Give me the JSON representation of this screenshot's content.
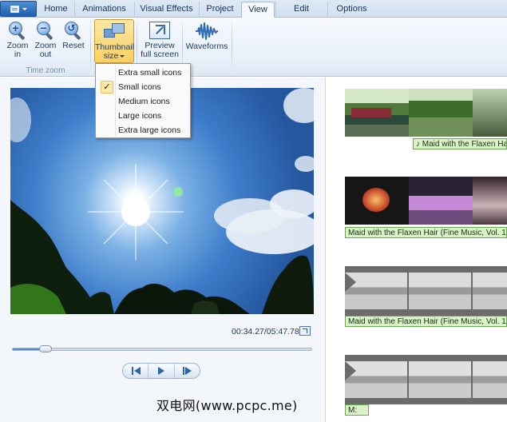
{
  "ribbon": {
    "tabs": [
      "Home",
      "Animations",
      "Visual Effects",
      "Project",
      "View",
      "Edit",
      "Options"
    ],
    "active_tab": "View",
    "zoom_in_label": [
      "Zoom",
      "in"
    ],
    "zoom_out_label": [
      "Zoom",
      "out"
    ],
    "reset_label": "Reset",
    "time_zoom_group": "Time zoom",
    "thumbnail_size_label": [
      "Thumbnail",
      "size"
    ],
    "preview_full_screen_label": [
      "Preview",
      "full screen"
    ],
    "waveforms_label": "Waveforms"
  },
  "thumbnail_menu": {
    "items": [
      "Extra small icons",
      "Small icons",
      "Medium icons",
      "Large icons",
      "Extra large icons"
    ],
    "checked": "Small icons"
  },
  "player": {
    "timecode": "00:34.27/05:47.78",
    "seek_progress": 0.11
  },
  "storyboard": {
    "music_labels": [
      "♪ Maid with the Flaxen Hair (",
      "Maid with the Flaxen Hair (Fine Music, Vol. 1",
      "Maid with the Flaxen Hair (Fine Music, Vol. 1",
      "M:"
    ]
  },
  "watermark": "双电网(www.pcpc.me)",
  "colors": {
    "ribbon_accent": "#fde8a4",
    "music_caption_bg": "#d9f2c8",
    "music_caption_border": "#6aa84f"
  },
  "icons": [
    "app-menu-icon",
    "zoom-in-icon",
    "zoom-out-icon",
    "reset-icon",
    "thumbnail-size-icon",
    "preview-full-screen-icon",
    "waveform-icon",
    "checkmark-icon",
    "expand-icon",
    "previous-frame-icon",
    "play-icon",
    "next-frame-icon"
  ]
}
